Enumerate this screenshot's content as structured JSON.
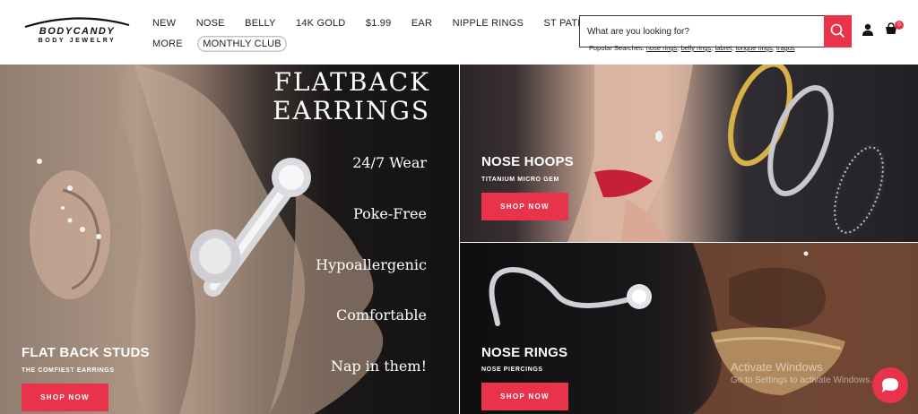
{
  "logo": {
    "brand": "BODYCANDY",
    "tagline": "BODY JEWELRY"
  },
  "nav": {
    "row1": [
      "NEW",
      "NOSE",
      "BELLY",
      "14K GOLD",
      "$1.99",
      "EAR",
      "NIPPLE RINGS",
      "ST PATRICK'S DAY"
    ],
    "row2": [
      "MORE",
      "MONTHLY CLUB"
    ]
  },
  "search": {
    "placeholder": "What are you looking for?",
    "popular_label": "Popular Searches:",
    "popular_terms": [
      "nose rings",
      "belly rings",
      "labret",
      "tongue rings",
      "tragus"
    ]
  },
  "cart": {
    "count": "0"
  },
  "hero": {
    "left": {
      "banner_title_line1": "FLATBACK",
      "banner_title_line2": "EARRINGS",
      "features": [
        "24/7 Wear",
        "Poke-Free",
        "Hypoallergenic",
        "Comfortable",
        "Nap in them!"
      ],
      "title": "FLAT BACK STUDS",
      "subtitle": "THE COMFIEST EARRINGS",
      "button": "SHOP NOW"
    },
    "nose_hoops": {
      "title": "NOSE HOOPS",
      "subtitle": "TITANIUM MICRO GEM",
      "button": "SHOP NOW"
    },
    "nose_rings": {
      "title": "NOSE RINGS",
      "subtitle": "NOSE PIERCINGS",
      "button": "SHOP NOW"
    }
  },
  "system": {
    "watermark_line1": "Activate Windows",
    "watermark_line2": "Go to Settings to activate Windows."
  },
  "colors": {
    "accent": "#e8334a",
    "text": "#222222"
  },
  "icons": {
    "search": "search-icon",
    "user": "user-icon",
    "cart": "cart-icon",
    "chat": "chat-icon"
  }
}
